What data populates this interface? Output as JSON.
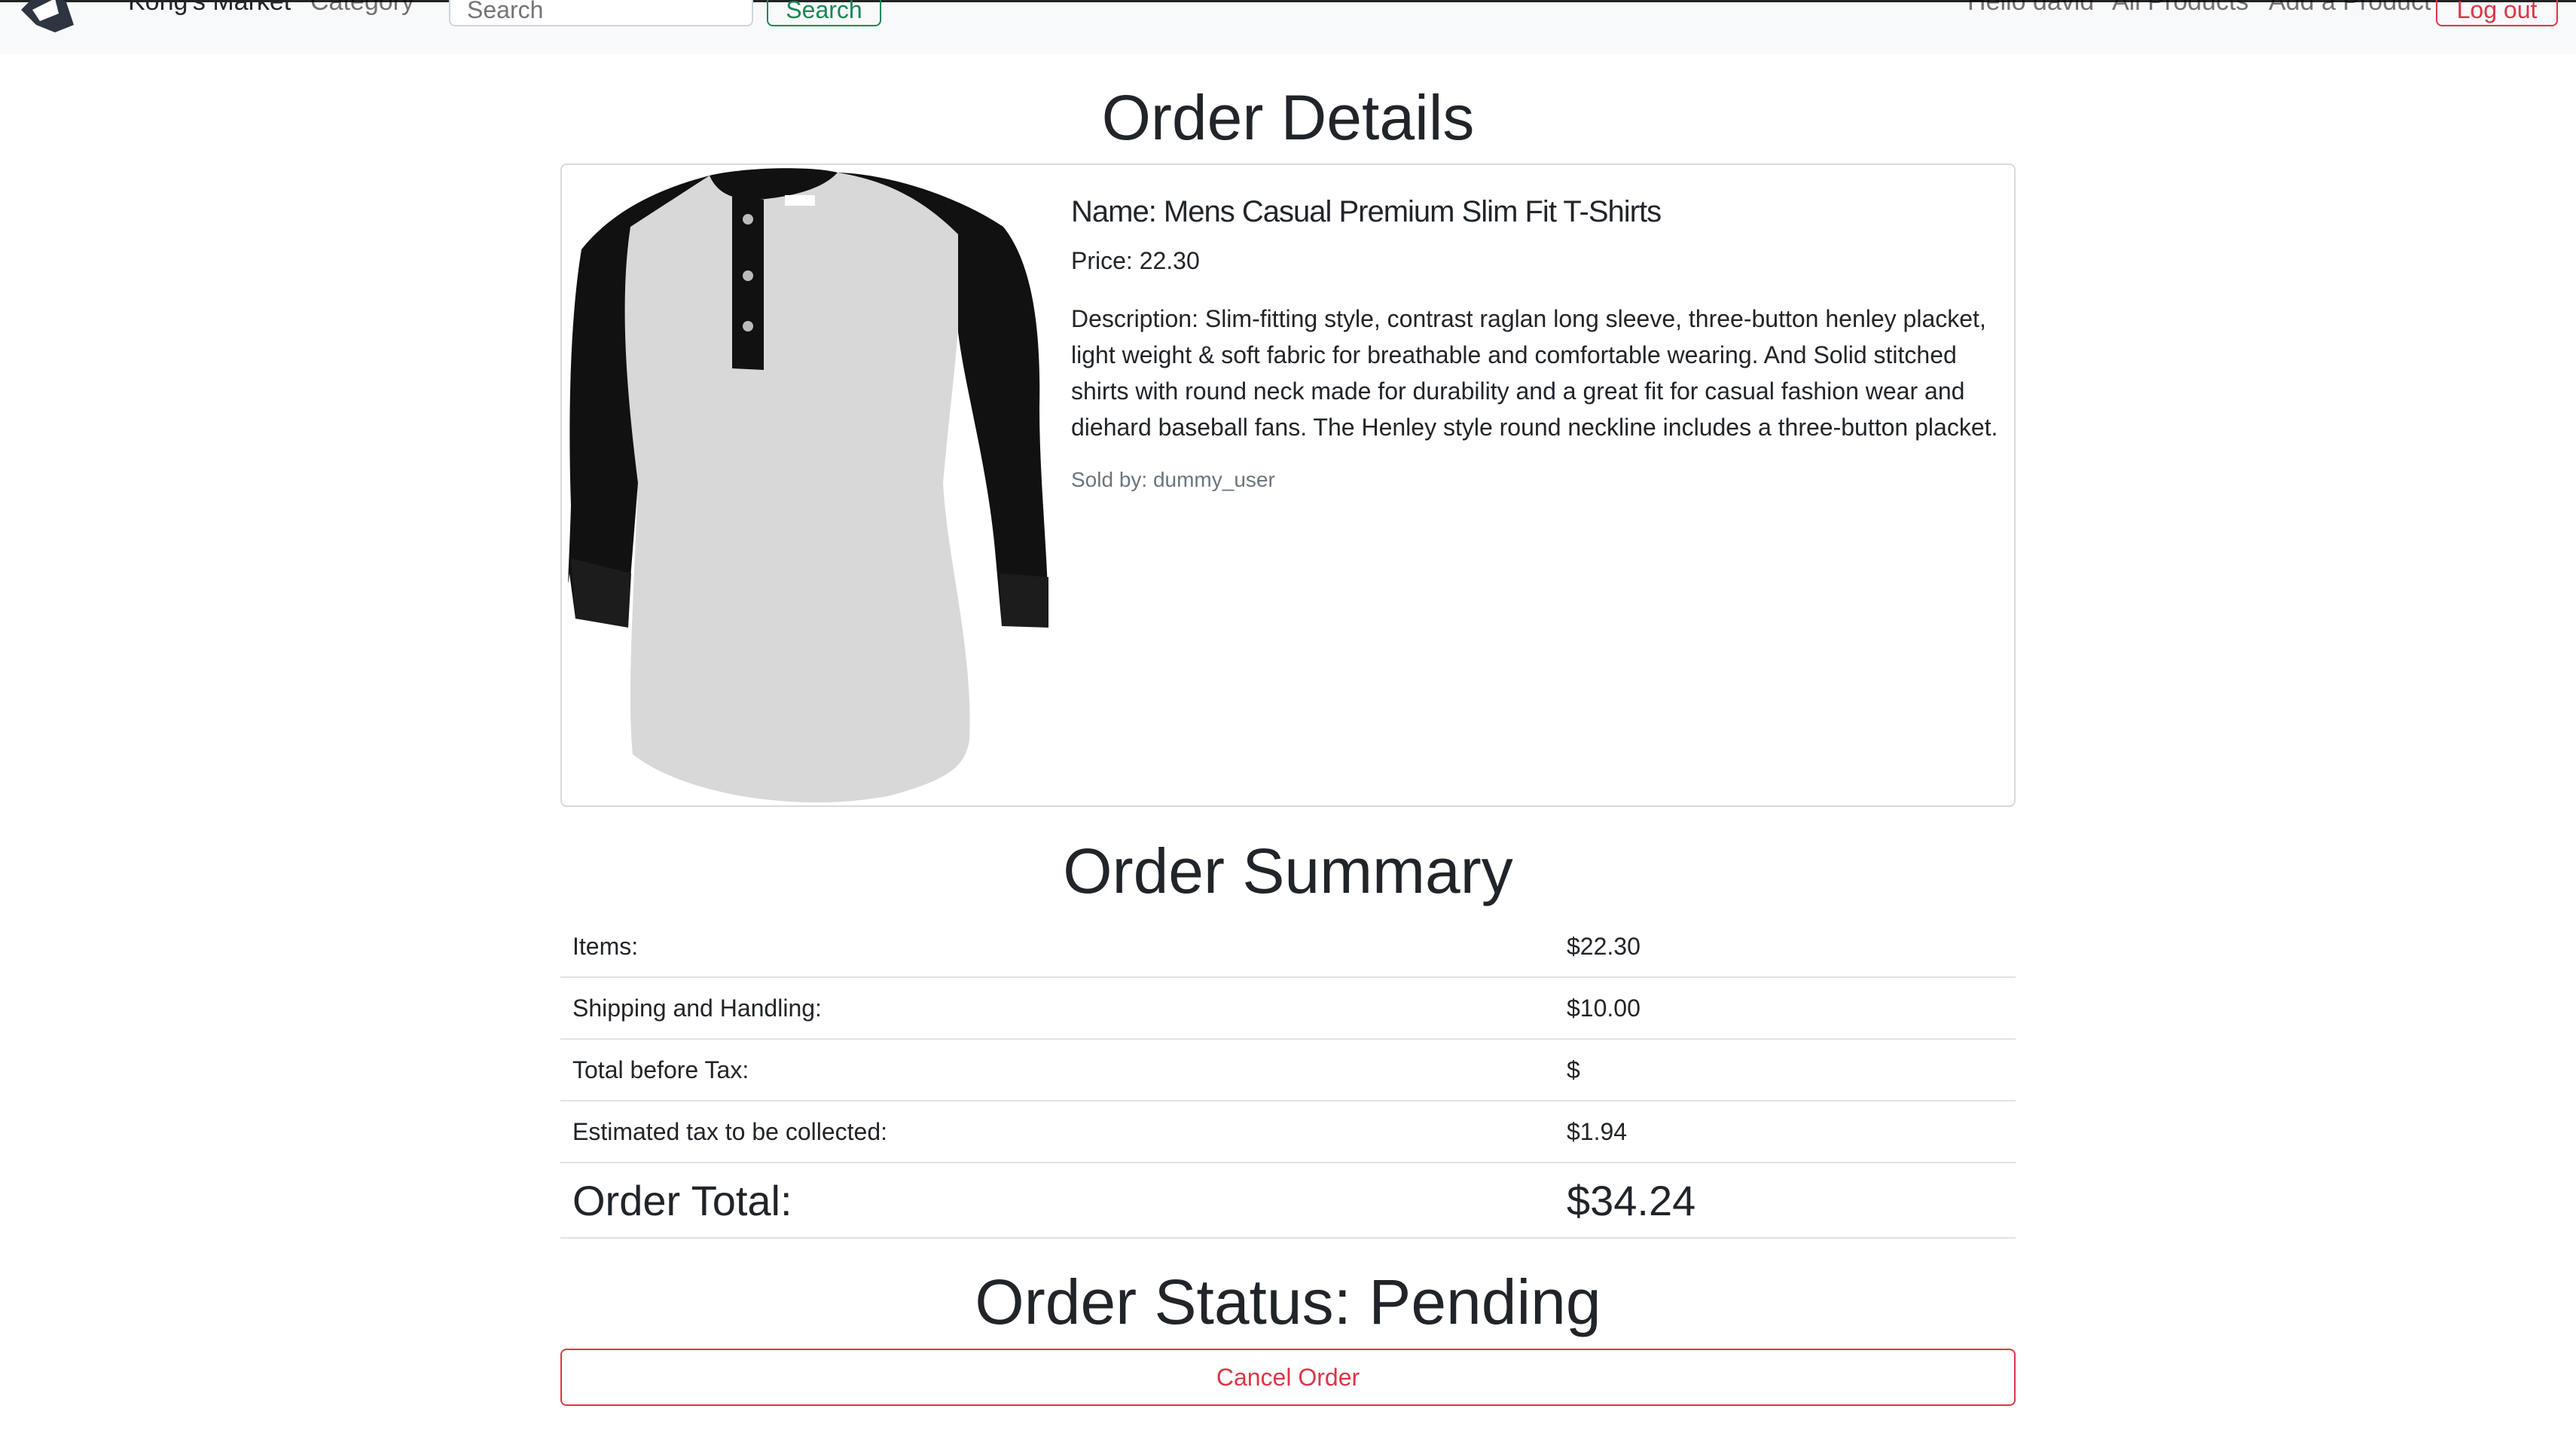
{
  "navbar": {
    "logo_icon": "knight-helmet-logo",
    "brand": "Kong's Market",
    "category_label": "Category",
    "search_placeholder": "Search",
    "search_button": "Search",
    "greeting": "Hello david",
    "all_products": "All Products",
    "add_product": "Add a Product",
    "logout_button": "Log out"
  },
  "order_details": {
    "title": "Order Details",
    "product": {
      "image_icon": "henley-raglan-shirt-image",
      "name": "Name: Mens Casual Premium Slim Fit T-Shirts",
      "price": "Price: 22.30",
      "description": "Description: Slim-fitting style, contrast raglan long sleeve, three-button henley placket, light weight & soft fabric for breathable and comfortable wearing. And Solid stitched shirts with round neck made for durability and a great fit for casual fashion wear and diehard baseball fans. The Henley style round neckline includes a three-button placket.",
      "sold_by": "Sold by: dummy_user"
    }
  },
  "order_summary": {
    "title": "Order Summary",
    "rows": [
      {
        "label": "Items:",
        "value": "$22.30"
      },
      {
        "label": "Shipping and Handling:",
        "value": "$10.00"
      },
      {
        "label": "Total before Tax:",
        "value": "$"
      },
      {
        "label": "Estimated tax to be collected:",
        "value": "$1.94"
      }
    ],
    "total": {
      "label": "Order Total:",
      "value": "$34.24"
    }
  },
  "order_status": {
    "title": "Order Status: Pending",
    "cancel_button": "Cancel Order"
  },
  "colors": {
    "danger": "#dc3545",
    "success": "#198754",
    "navbar_bg": "#f8f9fa",
    "text": "#212529"
  }
}
